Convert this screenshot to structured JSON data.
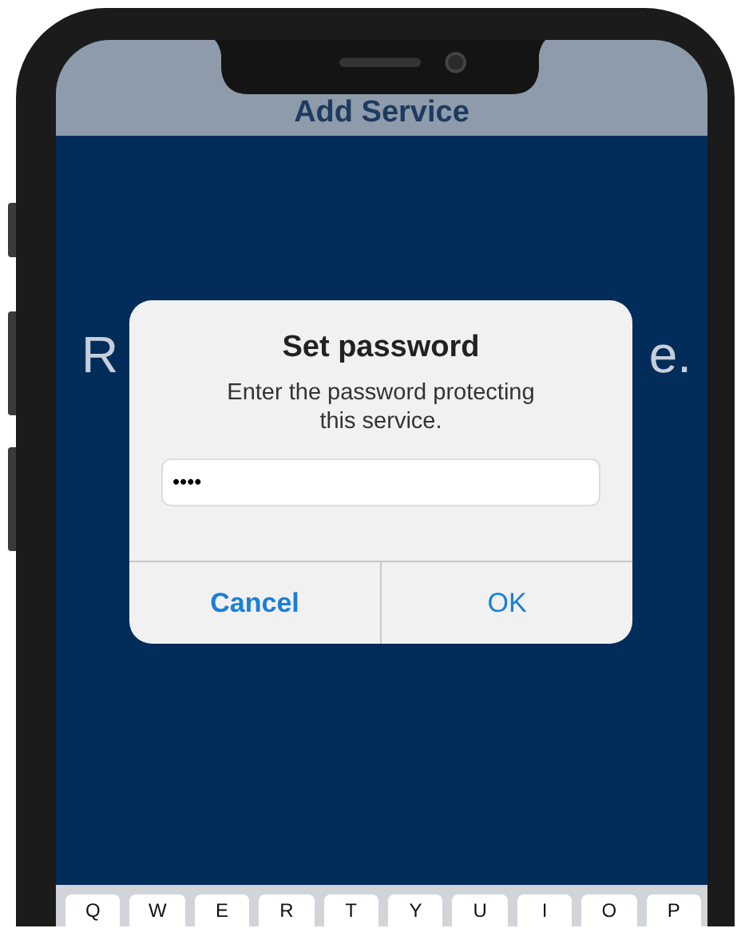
{
  "header": {
    "title": "Add Service"
  },
  "background_text": [
    "R",
    "e."
  ],
  "dialog": {
    "title": "Set password",
    "message": "Enter the password protecting this service.",
    "field": {
      "value": "••••"
    },
    "buttons": [
      {
        "label": "Cancel",
        "bold": true
      },
      {
        "label": "OK",
        "bold": false
      }
    ]
  },
  "keyboard": {
    "keys": [
      "Q",
      "W",
      "E",
      "R",
      "T",
      "Y",
      "U",
      "I",
      "O",
      "P"
    ]
  }
}
